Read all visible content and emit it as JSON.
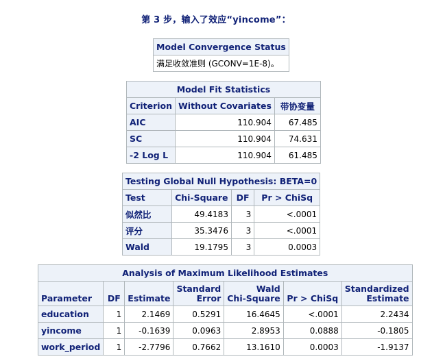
{
  "step_title": "第 3 步，输入了效应“yincome”：",
  "convergence": {
    "caption": "Model Convergence Status",
    "message": "满足收敛准则 (GCONV=1E-8)。"
  },
  "fit_stats": {
    "caption": "Model Fit Statistics",
    "headers": [
      "Criterion",
      "Without Covariates",
      "带协变量"
    ],
    "rows": [
      {
        "criterion": "AIC",
        "without": "110.904",
        "with": "67.485"
      },
      {
        "criterion": "SC",
        "without": "110.904",
        "with": "74.631"
      },
      {
        "criterion": "-2 Log L",
        "without": "110.904",
        "with": "61.485"
      }
    ]
  },
  "global_null": {
    "caption": "Testing Global Null Hypothesis: BETA=0",
    "headers": [
      "Test",
      "Chi-Square",
      "DF",
      "Pr > ChiSq"
    ],
    "rows": [
      {
        "test": "似然比",
        "chisq": "49.4183",
        "df": "3",
        "p": "<.0001"
      },
      {
        "test": "评分",
        "chisq": "35.3476",
        "df": "3",
        "p": "<.0001"
      },
      {
        "test": "Wald",
        "chisq": "19.1795",
        "df": "3",
        "p": "0.0003"
      }
    ]
  },
  "mle": {
    "caption": "Analysis of Maximum Likelihood Estimates",
    "headers": {
      "parameter": "Parameter",
      "df": "DF",
      "estimate": "Estimate",
      "se_1": "Standard",
      "se_2": "Error",
      "wald_1": "Wald",
      "wald_2": "Chi-Square",
      "p": "Pr > ChiSq",
      "std_1": "Standardized",
      "std_2": "Estimate"
    },
    "rows": [
      {
        "param": "education",
        "df": "1",
        "est": "2.1469",
        "se": "0.5291",
        "chisq": "16.4645",
        "p": "<.0001",
        "std": "2.2434"
      },
      {
        "param": "yincome",
        "df": "1",
        "est": "-0.1639",
        "se": "0.0963",
        "chisq": "2.8953",
        "p": "0.0888",
        "std": "-0.1805"
      },
      {
        "param": "work_period",
        "df": "1",
        "est": "-2.7796",
        "se": "0.7662",
        "chisq": "13.1610",
        "p": "0.0003",
        "std": "-1.9137"
      }
    ]
  }
}
